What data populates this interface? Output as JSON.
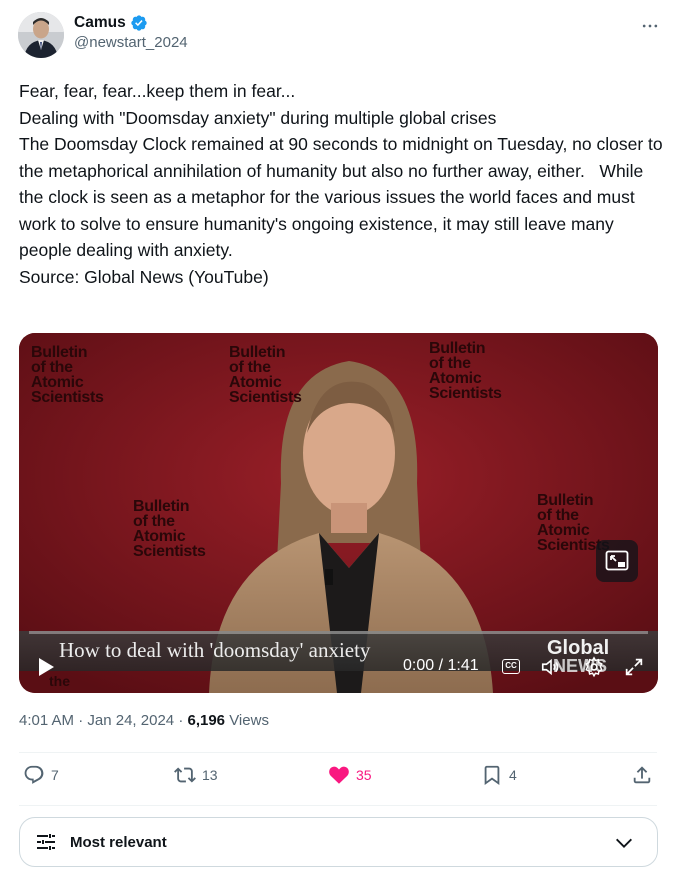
{
  "author": {
    "name": "Camus",
    "handle": "@newstart_2024",
    "verified": true
  },
  "tweet": {
    "lines": [
      "Fear, fear, fear...keep them in fear...",
      "Dealing with \"Doomsday anxiety\" during multiple global crises",
      "The Doomsday Clock remained at 90 seconds to midnight on Tuesday, no closer to the metaphorical annihilation of humanity but also no further away, either.   While the clock is seen as a metaphor for the various issues the world faces and must work to solve to ensure humanity's ongoing existence, it may still leave many people dealing with anxiety.",
      "Source: Global News (YouTube)"
    ]
  },
  "video": {
    "backdrop_text": [
      "Bulletin",
      "of the",
      "Atomic",
      "Scientists"
    ],
    "lower_third_title": "How to deal with 'doomsday' anxiety",
    "time": "0:00 / 1:41",
    "cc_label": "CC",
    "brand": "Global",
    "brand_sub": "NEWS",
    "fragment_text": "the",
    "progress_fraction": 0.0
  },
  "meta": {
    "time": "4:01 AM",
    "date": "Jan 24, 2024",
    "views_count": "6,196",
    "views_label": "Views"
  },
  "actions": {
    "replies": "7",
    "reposts": "13",
    "likes": "35",
    "bookmarks": "4"
  },
  "sort": {
    "label": "Most relevant"
  },
  "colors": {
    "accent": "#1d9bf0",
    "like": "#f91880",
    "muted": "#536471",
    "backdrop": "#7a161e"
  }
}
